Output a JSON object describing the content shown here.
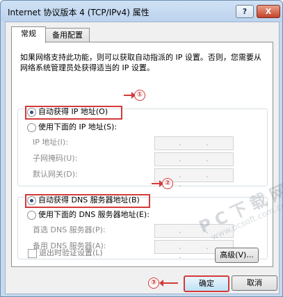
{
  "window": {
    "title": "Internet 协议版本 4 (TCP/IPv4) 属性",
    "help_label": "?",
    "close_label": "X"
  },
  "tabs": [
    {
      "label": "常规",
      "active": true
    },
    {
      "label": "备用配置",
      "active": false
    }
  ],
  "description": "如果网络支持此功能，则可以获取自动指派的 IP 设置。否则，您需要从网络系统管理员处获得适当的 IP 设置。",
  "ip_section": {
    "auto_label": "自动获得 IP 地址(O)",
    "manual_label": "使用下面的 IP 地址(S):",
    "selected": "auto",
    "fields": [
      {
        "label": "IP 地址(I):",
        "value": ". . ."
      },
      {
        "label": "子网掩码(U):",
        "value": ". . ."
      },
      {
        "label": "默认网关(D):",
        "value": ". . ."
      }
    ]
  },
  "dns_section": {
    "auto_label": "自动获得 DNS 服务器地址(B)",
    "manual_label": "使用下面的 DNS 服务器地址(E):",
    "selected": "auto",
    "fields": [
      {
        "label": "首选 DNS 服务器(P):",
        "value": ". . ."
      },
      {
        "label": "备用 DNS 服务器(A):",
        "value": ". . ."
      }
    ]
  },
  "validate_on_exit": {
    "label": "退出时验证设置(L)",
    "checked": false
  },
  "buttons": {
    "advanced": "高级(V)...",
    "ok": "确定",
    "cancel": "取消"
  },
  "annotations": {
    "one": "①",
    "two": "②",
    "three": "③",
    "color": "#d23a3a"
  },
  "watermark": {
    "main": "PC下载网",
    "sub": "www.pcsoft.com.cn"
  }
}
